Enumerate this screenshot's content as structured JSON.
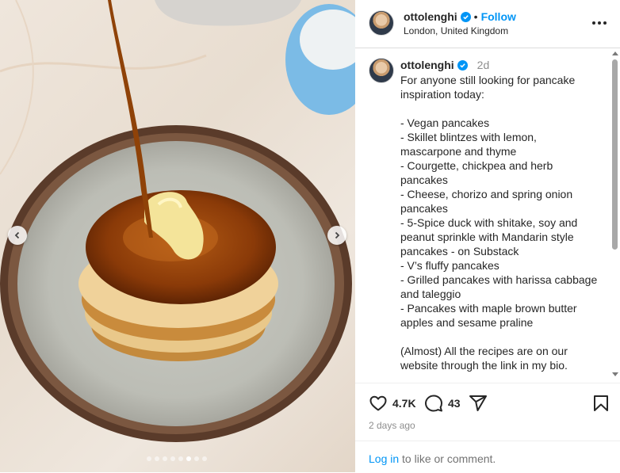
{
  "post": {
    "username": "ottolenghi",
    "follow_label": "Follow",
    "separator": "•",
    "location": "London, United Kingdom",
    "time_ago": "2d",
    "caption": "For anyone still looking for pancake inspiration today:\n\n- Vegan pancakes\n- Skillet blintzes with lemon, mascarpone and thyme\n- Courgette, chickpea and herb pancakes\n- Cheese, chorizo and spring onion pancakes\n- 5-Spice duck with shitake, soy and peanut sprinkle with Mandarin style pancakes - on Substack\n- V’s fluffy pancakes\n- Grilled pancakes with harissa cabbage and taleggio\n- Pancakes with maple brown butter apples and sesame praline\n\n(Almost) All the recipes are on our website through the link in my bio.",
    "likes": "4.7K",
    "comments": "43",
    "date": "2 days ago"
  },
  "footer": {
    "login_link": "Log in",
    "login_suffix": " to like or comment."
  },
  "carousel": {
    "slide_count": 8,
    "active_index": 5
  },
  "icons": {
    "verified": "verified-badge-icon",
    "more": "more-options-icon",
    "like": "heart-icon",
    "comment": "comment-bubble-icon",
    "share": "paper-plane-icon",
    "save": "bookmark-icon",
    "prev": "chevron-left-icon",
    "next": "chevron-right-icon"
  },
  "colors": {
    "accent": "#0095f6",
    "text": "#262626",
    "muted": "#8e8e8e"
  }
}
